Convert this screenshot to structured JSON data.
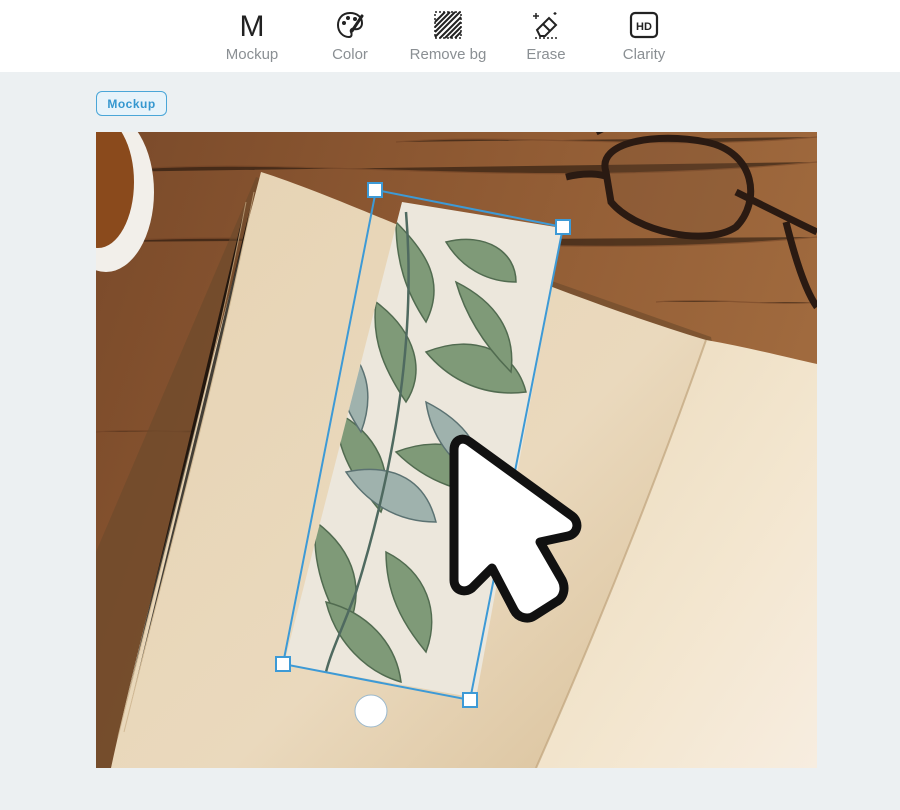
{
  "toolbar": {
    "tools": [
      {
        "label": "Mockup",
        "icon": "m-letter-icon"
      },
      {
        "label": "Color",
        "icon": "palette-icon"
      },
      {
        "label": "Remove bg",
        "icon": "hatch-icon"
      },
      {
        "label": "Erase",
        "icon": "eraser-icon"
      },
      {
        "label": "Clarity",
        "icon": "hd-icon"
      }
    ],
    "mockup_glyph": "M",
    "clarity_glyph": "HD"
  },
  "badge": {
    "label": "Mockup"
  },
  "colors": {
    "accent": "#4aa6d8",
    "toolbar_bg": "#ffffff",
    "page_bg": "#ecf0f2",
    "label_gray": "#8a8f93"
  },
  "scene": {
    "description_icons": [
      "book",
      "bookmark",
      "glasses",
      "tea-cup",
      "cursor"
    ]
  }
}
